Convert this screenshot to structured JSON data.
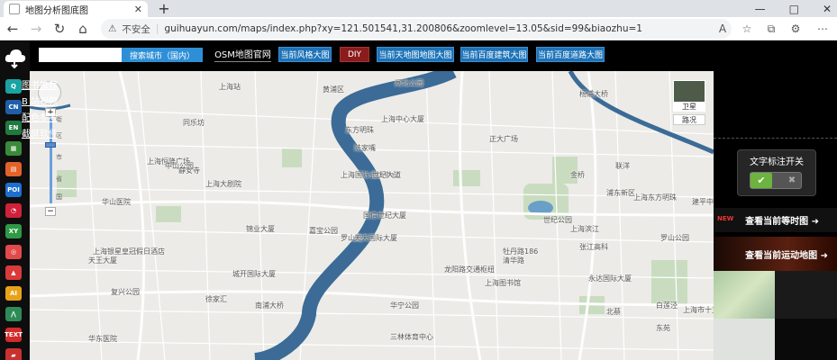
{
  "browser": {
    "tab_title": "地图分析图底图",
    "tab_close": "✕",
    "new_tab": "+",
    "security_label": "不安全",
    "url": "guihuayun.com/maps/index.php?xy=121.501541,31.200806&zoomlevel=13.05&sid=99&biaozhu=1",
    "window_controls": [
      "—",
      "□",
      "✕"
    ]
  },
  "dock": {
    "items": [
      {
        "icon": "q-icon",
        "text": "Q",
        "color": "#1aa3a3"
      },
      {
        "icon": "cn-icon",
        "text": "CN",
        "color": "#1f5fa8"
      },
      {
        "icon": "en-icon",
        "text": "EN",
        "color": "#1f7a3f"
      },
      {
        "icon": "grid-icon",
        "text": "▦",
        "color": "#3a8a3a"
      },
      {
        "icon": "layers-icon",
        "text": "▤",
        "color": "#e4622a"
      },
      {
        "icon": "poi-icon",
        "text": "POI",
        "color": "#1c6fd1"
      },
      {
        "icon": "pie-icon",
        "text": "◔",
        "color": "#d0213a"
      },
      {
        "icon": "xy-icon",
        "text": "XY",
        "color": "#2d9a45"
      },
      {
        "icon": "pin-icon",
        "text": "◎",
        "color": "#e2494a"
      },
      {
        "icon": "chart-icon",
        "text": "▲",
        "color": "#d93a3a"
      },
      {
        "icon": "ai-icon",
        "text": "AI",
        "color": "#e8a21a"
      },
      {
        "icon": "road-icon",
        "text": "⋀",
        "color": "#2e8b57"
      },
      {
        "icon": "text-icon",
        "text": "TEXT",
        "color": "#d12b2b"
      },
      {
        "icon": "flag-icon",
        "text": "▰",
        "color": "#c8312f"
      }
    ]
  },
  "toolbar": {
    "search_placeholder": "",
    "search_button": "搜索城市（国内）",
    "osm_label": "OSM地图官网",
    "buttons": [
      "当前风格大图",
      "DIY",
      "当前天地图地图大图",
      "当前百度建筑大图",
      "当前百度道路大图"
    ]
  },
  "map_controls": {
    "zoom_in": "+",
    "zoom_out": "−",
    "zoom_tags": [
      "街",
      "区",
      "市",
      "省",
      "国"
    ],
    "satellite_label": "卫星",
    "road_label": "路况"
  },
  "map_labels": [
    "上海站",
    "黄浦区",
    "闸北公园",
    "同乐坊",
    "静安寺",
    "上海恒隆广场",
    "中山公园",
    "华山医院",
    "上海大剧院",
    "东方明珠",
    "上海中心大厦",
    "上海国际会议中心",
    "陆家嘴",
    "世纪大道",
    "国信世纪大厦",
    "锦业大厦",
    "嘉宝公园",
    "罗山路",
    "天天国际大厦",
    "上海银星皇冠假日酒店",
    "天王大厦",
    "城开国际大厦",
    "徐家汇",
    "龙阳路交通枢纽",
    "上海图书馆",
    "南浦大桥",
    "复兴公园",
    "三林体育中心",
    "上海滨江",
    "浦东新区",
    "杨浦大桥",
    "正大广场",
    "金桥",
    "联洋",
    "世纪公园",
    "牡丹路186",
    "清华路",
    "上海东方明珠",
    "张江高科",
    "永达国际大厦",
    "白莲泾",
    "北蔡",
    "上海市十五中心",
    "罗山公园",
    "建平中学",
    "华宁公园",
    "华东医院",
    "东苑"
  ],
  "right_panel": {
    "links": [
      "图书推荐",
      "B 站视频",
      "配色参考",
      "截屏软件"
    ],
    "toggle_title": "文字标注开关",
    "toggle_on": "✔",
    "toggle_off": "✖",
    "banner1": "查看当前等时图 ➜",
    "banner1_badge": "NEW",
    "banner2": "查看当前运动地图 ➜"
  }
}
